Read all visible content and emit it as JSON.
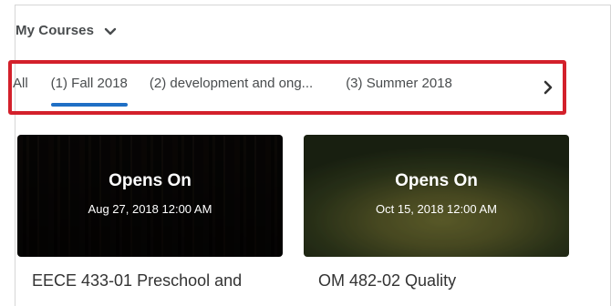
{
  "header": {
    "title": "My Courses"
  },
  "tabs": [
    {
      "label": "All"
    },
    {
      "label": "(1) Fall 2018"
    },
    {
      "label": "(2) development and ong..."
    },
    {
      "label": "(3) Summer 2018"
    }
  ],
  "courses": [
    {
      "status": "Opens On",
      "date": "Aug 27, 2018 12:00 AM",
      "title": "EECE 433-01 Preschool and"
    },
    {
      "status": "Opens On",
      "date": "Oct 15, 2018 12:00 AM",
      "title": "OM 482-02 Quality"
    }
  ],
  "colors": {
    "highlight_border": "#d3202b",
    "active_tab": "#1f6fc5"
  },
  "icons": {
    "dropdown": "chevron-down-icon",
    "next": "chevron-right-icon"
  }
}
